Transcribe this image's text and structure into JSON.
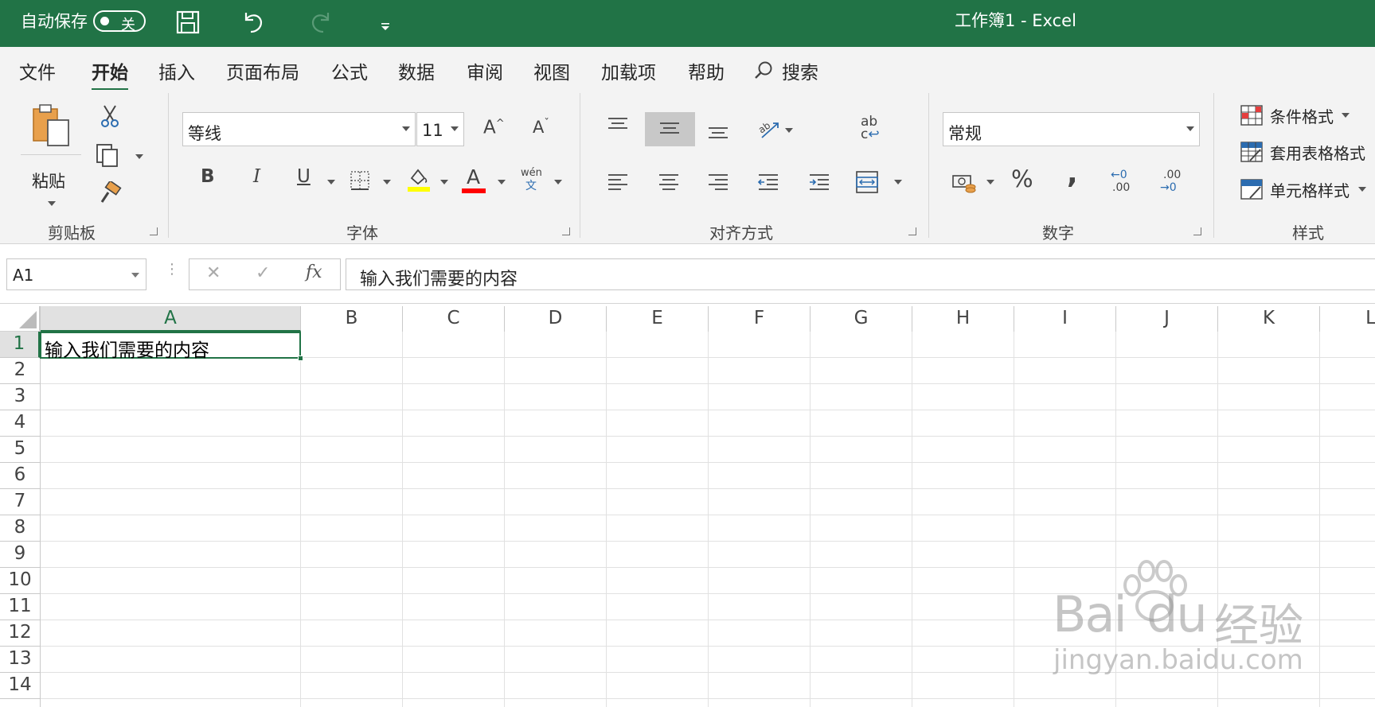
{
  "titlebar": {
    "autosave_label": "自动保存",
    "autosave_state": "关",
    "doc_title": "工作簿1  -  Excel",
    "save_icon": "save-icon",
    "undo_icon": "undo-icon",
    "redo_icon": "redo-icon",
    "customize_icon": "customize-qat-icon",
    "brand_color": "#217346"
  },
  "tabs": [
    {
      "label": "文件"
    },
    {
      "label": "开始",
      "active": true
    },
    {
      "label": "插入"
    },
    {
      "label": "页面布局"
    },
    {
      "label": "公式"
    },
    {
      "label": "数据"
    },
    {
      "label": "审阅"
    },
    {
      "label": "视图"
    },
    {
      "label": "加载项"
    },
    {
      "label": "帮助"
    }
  ],
  "search": {
    "label": "搜索"
  },
  "ribbon": {
    "clipboard": {
      "paste_label": "粘贴",
      "group_label": "剪贴板"
    },
    "font": {
      "font_name": "等线",
      "font_size": "11",
      "bold": "B",
      "italic": "I",
      "underline": "U",
      "font_color_letter": "A",
      "phonetic_top": "wén",
      "phonetic_bottom": "文",
      "grow": "A",
      "shrink": "A",
      "group_label": "字体",
      "fill_color": "#ffff00",
      "text_color": "#ff0000"
    },
    "alignment": {
      "wrap_top": "ab",
      "wrap_bottom": "c",
      "group_label": "对齐方式"
    },
    "number": {
      "format": "常规",
      "percent": "%",
      "comma": ",",
      "inc_dec_top": "←0",
      "inc_dec_bottom": ".00",
      "dec_dec_top": ".00",
      "dec_dec_bottom": "→0",
      "group_label": "数字"
    },
    "styles": {
      "conditional": "条件格式",
      "table": "套用表格格式",
      "cell_styles": "单元格样式",
      "group_label": "样式"
    }
  },
  "formula_bar": {
    "name_box": "A1",
    "cancel": "✕",
    "enter": "✓",
    "fx": "fx",
    "content": "输入我们需要的内容"
  },
  "sheet": {
    "columns": [
      "A",
      "B",
      "C",
      "D",
      "E",
      "F",
      "G",
      "H",
      "I",
      "J",
      "K",
      "L"
    ],
    "rows": [
      "1",
      "2",
      "3",
      "4",
      "5",
      "6",
      "7",
      "8",
      "9",
      "10",
      "11",
      "12",
      "13",
      "14"
    ],
    "active_cell": "A1",
    "cells": {
      "A1": "输入我们需要的内容"
    }
  },
  "watermark": {
    "brand": "Bai",
    "brand2": "du",
    "cn": "经验",
    "url": "jingyan.baidu.com"
  }
}
